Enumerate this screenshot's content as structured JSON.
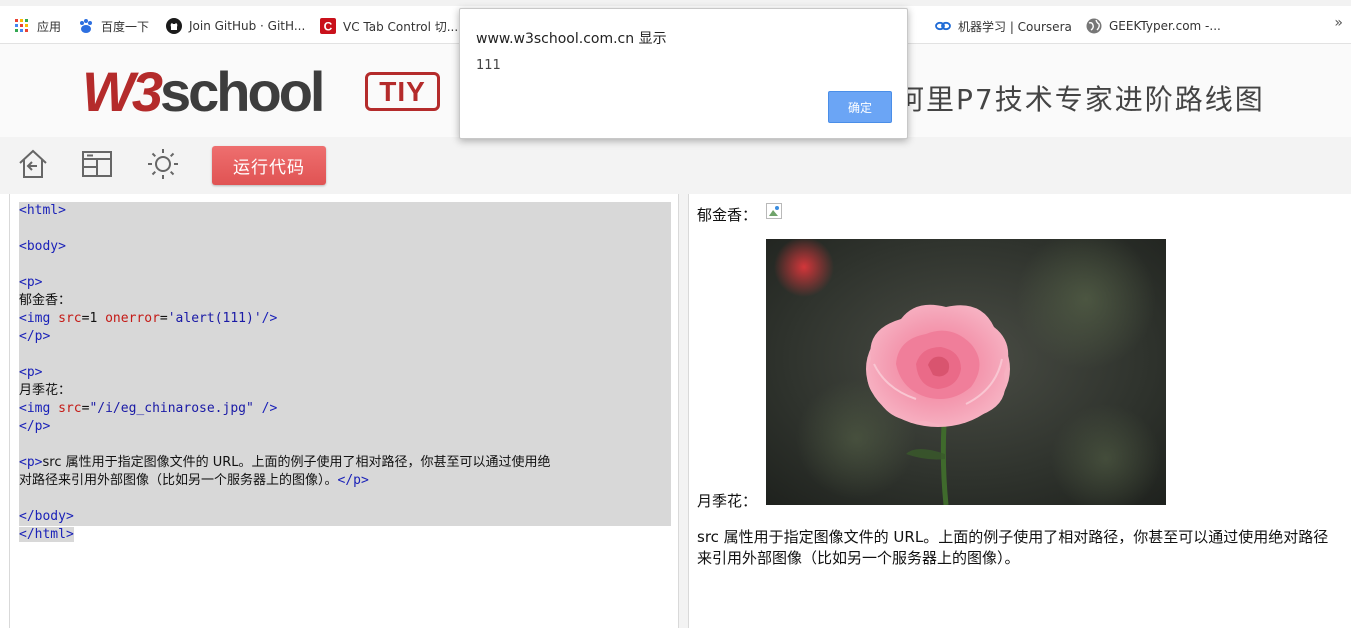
{
  "bookmarks": {
    "items": [
      {
        "label": "应用",
        "icon": "apps-grid-icon"
      },
      {
        "label": "百度一下",
        "icon": "baidu-paw-icon"
      },
      {
        "label": "Join GitHub · GitH...",
        "icon": "github-icon"
      },
      {
        "label": "VC Tab Control 切...",
        "icon": "csdn-c-icon"
      },
      {
        "label": "机器学习 | Coursera",
        "icon": "coursera-infinity-icon"
      },
      {
        "label": "GEEKTyper.com -...",
        "icon": "globe-icon"
      }
    ],
    "more": "»"
  },
  "header": {
    "logo_w3": "W3",
    "logo_school": "school",
    "tiy": "TIY",
    "banner": "阿里P7技术专家进阶路线图"
  },
  "toolbar": {
    "run_label": "运行代码",
    "icons": [
      "home-back-icon",
      "layout-icon",
      "theme-sun-icon"
    ]
  },
  "code": {
    "lines": [
      "<html>",
      "",
      "<body>",
      "",
      "<p>",
      "郁金香：",
      "<img src=1 onerror='alert(111)'/>",
      "</p>",
      "",
      "<p>",
      "月季花：",
      "<img src=\"/i/eg_chinarose.jpg\" />",
      "</p>",
      "",
      "<p>src 属性用于指定图像文件的 URL。上面的例子使用了相对路径，你甚至可以通过使用绝",
      "对路径来引用外部图像（比如另一个服务器上的图像）。</p>",
      "",
      "</body>",
      "</html>"
    ]
  },
  "result": {
    "p1_label": "郁金香：",
    "p2_label": "月季花：",
    "p3_text": "src 属性用于指定图像文件的 URL。上面的例子使用了相对路径，你甚至可以通过使用绝对路径来引用外部图像（比如另一个服务器上的图像）。"
  },
  "dialog": {
    "title": "www.w3school.com.cn 显示",
    "message": "111",
    "ok_label": "确定"
  },
  "colors": {
    "brand_red": "#b42b2b",
    "run_button": "#e05353",
    "dialog_button": "#6ba5f5",
    "selection": "#d8d8d8"
  }
}
